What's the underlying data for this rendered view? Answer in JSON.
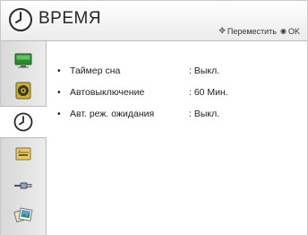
{
  "header": {
    "title": "ВРЕМЯ",
    "hint_move": "Переместить",
    "hint_ok": "OK"
  },
  "sidebar": {
    "items": [
      {
        "icon": "picture-icon",
        "active": false
      },
      {
        "icon": "speaker-icon",
        "active": false
      },
      {
        "icon": "clock-icon",
        "active": true
      },
      {
        "icon": "toolbox-icon",
        "active": false
      },
      {
        "icon": "cable-icon",
        "active": false
      },
      {
        "icon": "photos-icon",
        "active": false
      }
    ]
  },
  "settings": [
    {
      "bullet": "•",
      "label": "Таймер сна",
      "value": ": Выкл."
    },
    {
      "bullet": "•",
      "label": "Автовыключение",
      "value": ": 60 Мин."
    },
    {
      "bullet": "•",
      "label": "Авт. реж. ожидания",
      "value": ": Выкл."
    }
  ],
  "colors": {
    "header_bg": "#f0f0f0",
    "sidebar_bg": "#e0e0e0",
    "text": "#222222"
  }
}
